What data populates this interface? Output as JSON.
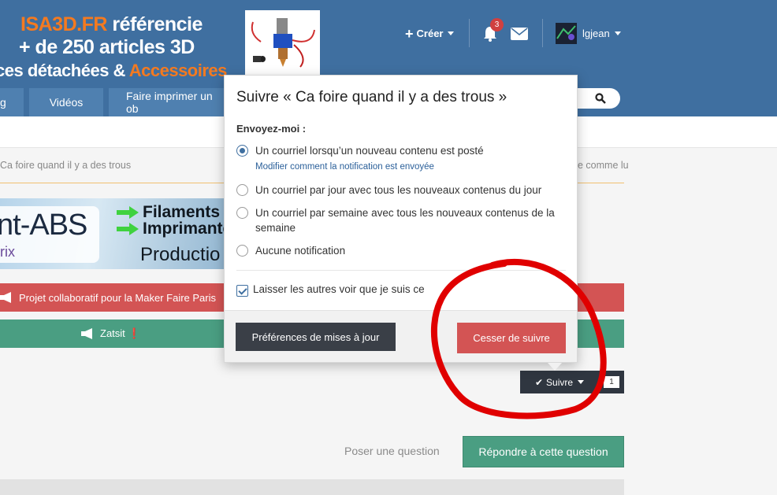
{
  "header": {
    "banner": {
      "line1_brand": "ISA3D.FR",
      "line1_rest": " référencie",
      "line2": "+ de 250 articles 3D",
      "line3_a": "ces détachées & ",
      "line3_b": "Accessoires"
    },
    "create_label": "Créer",
    "notification_count": "3",
    "username": "lgjean",
    "nav": [
      "g",
      "Vidéos",
      "Faire imprimer un ob"
    ]
  },
  "breadcrumb": {
    "current": "Ca foire quand il y a des trous",
    "right_fragment": "e comme lu"
  },
  "ad": {
    "abs": "nt-ABS",
    "rix": "rix",
    "filaments": "Filaments p",
    "imprimantes": "Imprimante",
    "production": "Productio"
  },
  "notices": {
    "red": "Projet collaboratif pour la Maker Faire Paris",
    "green": "Zatsit",
    "green_mark": "❗"
  },
  "follow": {
    "button_label": "Suivre",
    "count": "1"
  },
  "actions": {
    "ask": "Poser une question",
    "reply": "Répondre à cette question"
  },
  "popup": {
    "title": "Suivre « Ca foire quand il y a des trous »",
    "send_me": "Envoyez-moi :",
    "options": [
      "Un courriel lorsqu’un nouveau contenu est posté",
      "Un courriel par jour avec tous les nouveaux contenus du jour",
      "Un courriel par semaine avec tous les nouveaux contenus de la semaine",
      "Aucune notification"
    ],
    "selected_option": 0,
    "modify_link": "Modifier comment la notification est envoyée",
    "let_others_see": "Laisser les autres voir que je suis ce",
    "preferences_button": "Préférences de mises à jour",
    "unfollow_button": "Cesser de suivre"
  },
  "colors": {
    "header_blue": "#3f6fa0",
    "danger_red": "#d35454",
    "success_green": "#4a9e82",
    "annotation_red": "#e00000"
  }
}
